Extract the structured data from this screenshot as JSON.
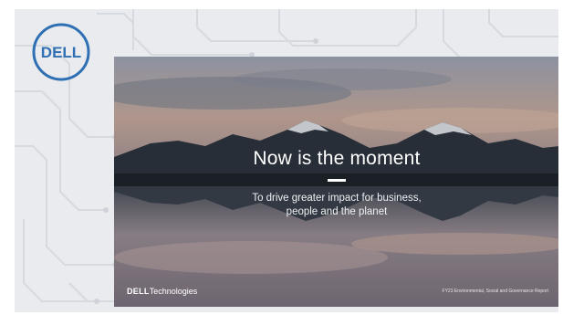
{
  "logo": {
    "text": "DELL",
    "color": "#2f6fb3"
  },
  "slide": {
    "headline": "Now is the moment",
    "subtitle_line1": "To drive greater impact for business,",
    "subtitle_line2": "people and the planet",
    "footer_brand_bold": "DELL",
    "footer_brand_rest": "Technologies",
    "footer_report": "FY23 Environmental, Social and Governance Report"
  }
}
